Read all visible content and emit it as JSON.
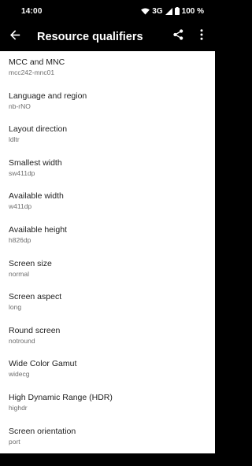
{
  "status_bar": {
    "time": "14:00",
    "network": "3G",
    "battery": "100 %"
  },
  "app_bar": {
    "title": "Resource qualifiers",
    "back_icon": "arrow-left-icon",
    "share_icon": "share-icon",
    "menu_icon": "more-vert-icon"
  },
  "items": [
    {
      "title": "MCC and MNC",
      "value": "mcc242-mnc01"
    },
    {
      "title": "Language and region",
      "value": "nb-rNO"
    },
    {
      "title": "Layout direction",
      "value": "ldltr"
    },
    {
      "title": "Smallest width",
      "value": "sw411dp"
    },
    {
      "title": "Available width",
      "value": "w411dp"
    },
    {
      "title": "Available height",
      "value": "h826dp"
    },
    {
      "title": "Screen size",
      "value": "normal"
    },
    {
      "title": "Screen aspect",
      "value": "long"
    },
    {
      "title": "Round screen",
      "value": "notround"
    },
    {
      "title": "Wide Color Gamut",
      "value": "widecg"
    },
    {
      "title": "High Dynamic Range (HDR)",
      "value": "highdr"
    },
    {
      "title": "Screen orientation",
      "value": "port"
    }
  ]
}
